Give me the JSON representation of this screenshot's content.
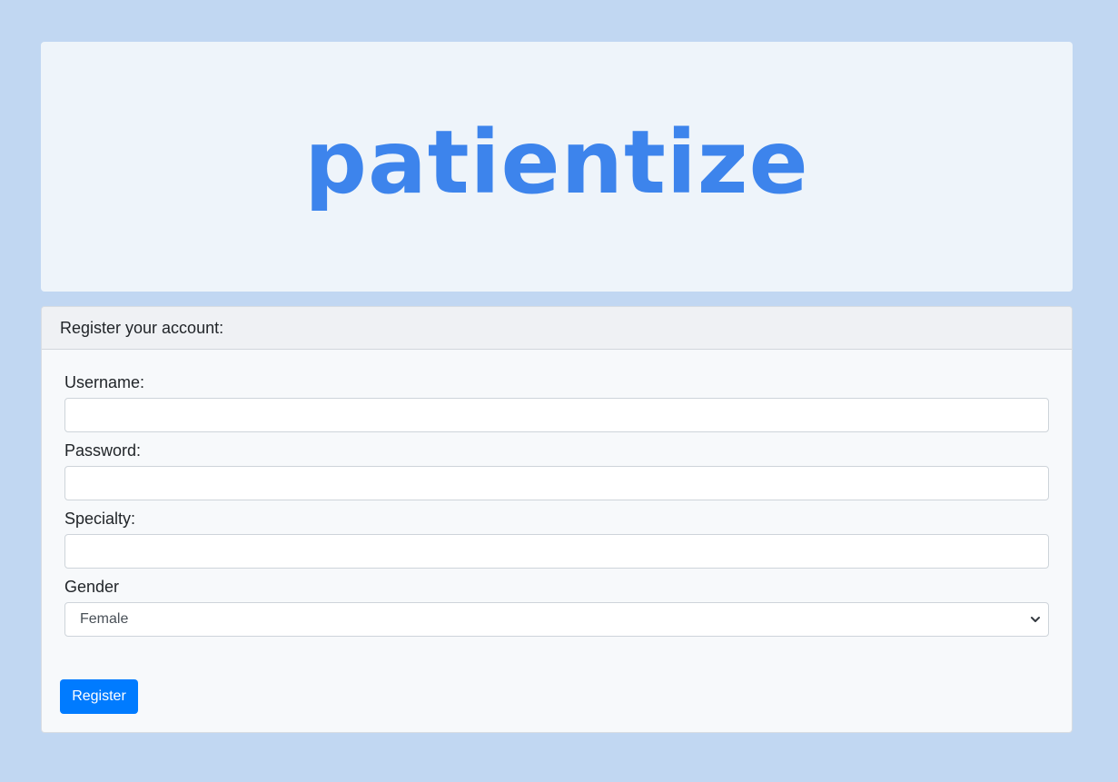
{
  "logo": {
    "text": "patientize",
    "color": "#3d84ec"
  },
  "form": {
    "header": "Register your account:",
    "fields": {
      "username": {
        "label": "Username:",
        "value": "",
        "placeholder": ""
      },
      "password": {
        "label": "Password:",
        "value": "",
        "placeholder": ""
      },
      "specialty": {
        "label": "Specialty:",
        "value": "",
        "placeholder": ""
      },
      "gender": {
        "label": "Gender",
        "selected": "Female"
      }
    },
    "submit_label": "Register",
    "accent_color": "#007bff"
  },
  "icons": {
    "select_arrow": "chevron-down-icon"
  }
}
